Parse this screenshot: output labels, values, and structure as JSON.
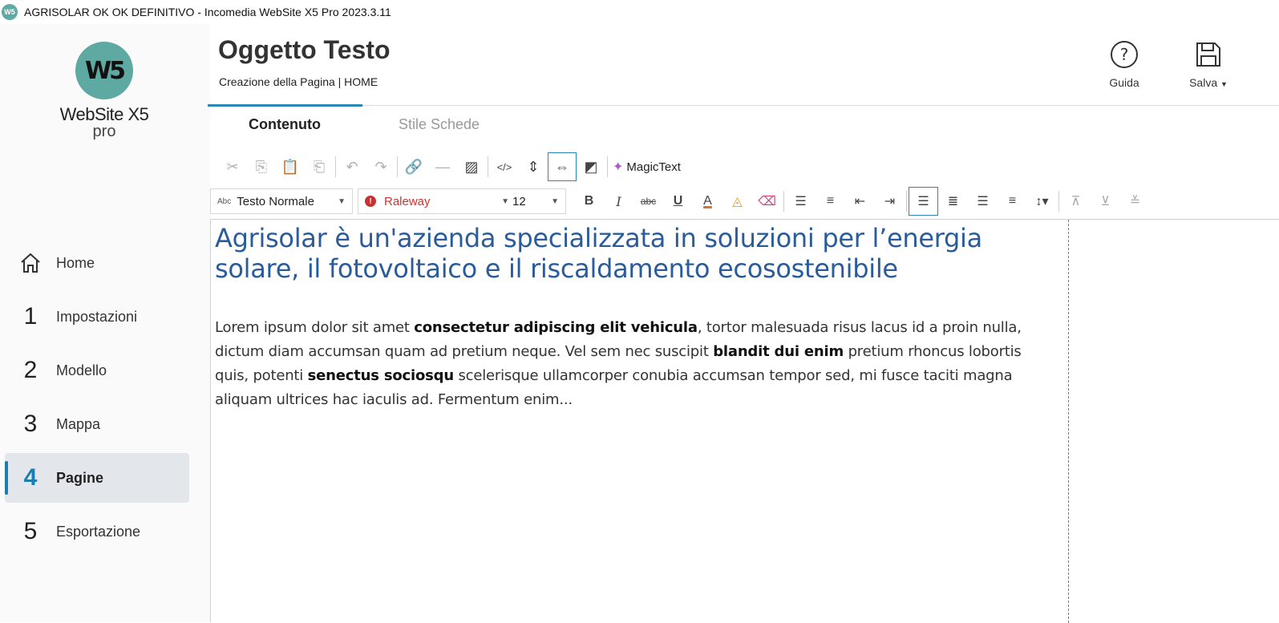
{
  "window": {
    "title": "AGRISOLAR OK OK DEFINITIVO - Incomedia WebSite X5 Pro 2023.3.11",
    "app_icon": "W5"
  },
  "logo": {
    "mark": "W5",
    "brand": "WebSite X5",
    "edition": "pro"
  },
  "sidebar": {
    "items": [
      {
        "num": "",
        "icon": "home-icon",
        "label": "Home"
      },
      {
        "num": "1",
        "label": "Impostazioni"
      },
      {
        "num": "2",
        "label": "Modello"
      },
      {
        "num": "3",
        "label": "Mappa"
      },
      {
        "num": "4",
        "label": "Pagine",
        "active": true
      },
      {
        "num": "5",
        "label": "Esportazione"
      }
    ]
  },
  "header": {
    "title": "Oggetto Testo",
    "subtitle": "Creazione della Pagina | HOME",
    "help_label": "Guida",
    "save_label": "Salva"
  },
  "tabs": [
    {
      "label": "Contenuto",
      "active": true
    },
    {
      "label": "Stile Schede",
      "active": false
    }
  ],
  "toolbar": {
    "magictext_label": "MagicText",
    "style_select": "Testo Normale",
    "style_select_prefix": "Abc",
    "font_select": "Raleway",
    "size_select": "12"
  },
  "editor": {
    "heading": "Agrisolar è un'azienda specializzata in soluzioni per l’energia solare, il fotovoltaico e il riscaldamento ecosostenibile",
    "body": "Lorem ipsum dolor sit amet consectetur adipiscing elit vehicula, tortor malesuada risus lacus id a proin nulla, dictum diam accumsan quam ad pretium neque. Vel sem nec suscipit blandit dui enim pretium rhoncus lobortis quis, potenti senectus sociosqu scelerisque ullamcorper conubia accumsan tempor sed, mi fusce taciti magna aliquam ultrices hac iaculis ad. Fermentum enim..."
  },
  "colors": {
    "accent": "#2a88b8",
    "logo": "#5fa9a3",
    "heading": "#2a5c9c",
    "warning": "#c63232"
  }
}
